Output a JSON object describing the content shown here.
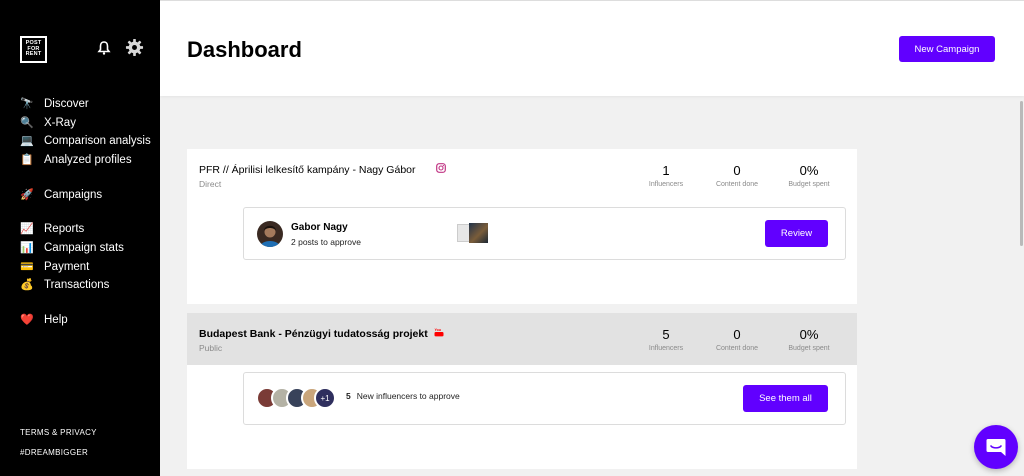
{
  "sidebar": {
    "logo": [
      "POST",
      "FOR",
      "RENT"
    ],
    "nav": [
      {
        "label": "Discover",
        "icon": "telescope-icon"
      },
      {
        "label": "X-Ray",
        "icon": "magnifier-icon"
      },
      {
        "label": "Comparison analysis",
        "icon": "computer-icon"
      },
      {
        "label": "Analyzed profiles",
        "icon": "clipboard-icon"
      },
      {
        "label": "Campaigns",
        "icon": "rocket-icon"
      },
      {
        "label": "Reports",
        "icon": "chart-increasing-icon"
      },
      {
        "label": "Campaign stats",
        "icon": "bar-chart-icon"
      },
      {
        "label": "Payment",
        "icon": "credit-card-icon"
      },
      {
        "label": "Transactions",
        "icon": "money-bag-icon"
      },
      {
        "label": "Help",
        "icon": "heart-icon"
      }
    ],
    "footer": {
      "terms": "TERMS & PRIVACY",
      "tagline": "#DREAMBIGGER"
    }
  },
  "header": {
    "title": "Dashboard",
    "new_campaign_label": "New Campaign"
  },
  "campaigns": [
    {
      "name": "PFR // Áprilisi lelkesítő kampány - Nagy Gábor",
      "type": "Direct",
      "platform": "instagram",
      "stats": [
        {
          "value": "1",
          "label": "Influencers"
        },
        {
          "value": "0",
          "label": "Content done"
        },
        {
          "value": "0%",
          "label": "Budget spent"
        }
      ],
      "pending": {
        "influencer_name": "Gabor Nagy",
        "subtitle": "2 posts to approve",
        "action_label": "Review"
      }
    },
    {
      "name": "Budapest Bank - Pénzügyi tudatosság projekt",
      "type": "Public",
      "platform": "youtube",
      "stats": [
        {
          "value": "5",
          "label": "Influencers"
        },
        {
          "value": "0",
          "label": "Content done"
        },
        {
          "value": "0%",
          "label": "Budget spent"
        }
      ],
      "pending": {
        "more_count": "+1",
        "new_count": "5",
        "new_text": "New influencers to approve",
        "action_label": "See them all"
      }
    }
  ],
  "colors": {
    "accent": "#6100ff",
    "sidebar_bg": "#000000",
    "page_bg": "#f1f1f1",
    "instagram": "#c13584",
    "youtube": "#ff0000"
  }
}
